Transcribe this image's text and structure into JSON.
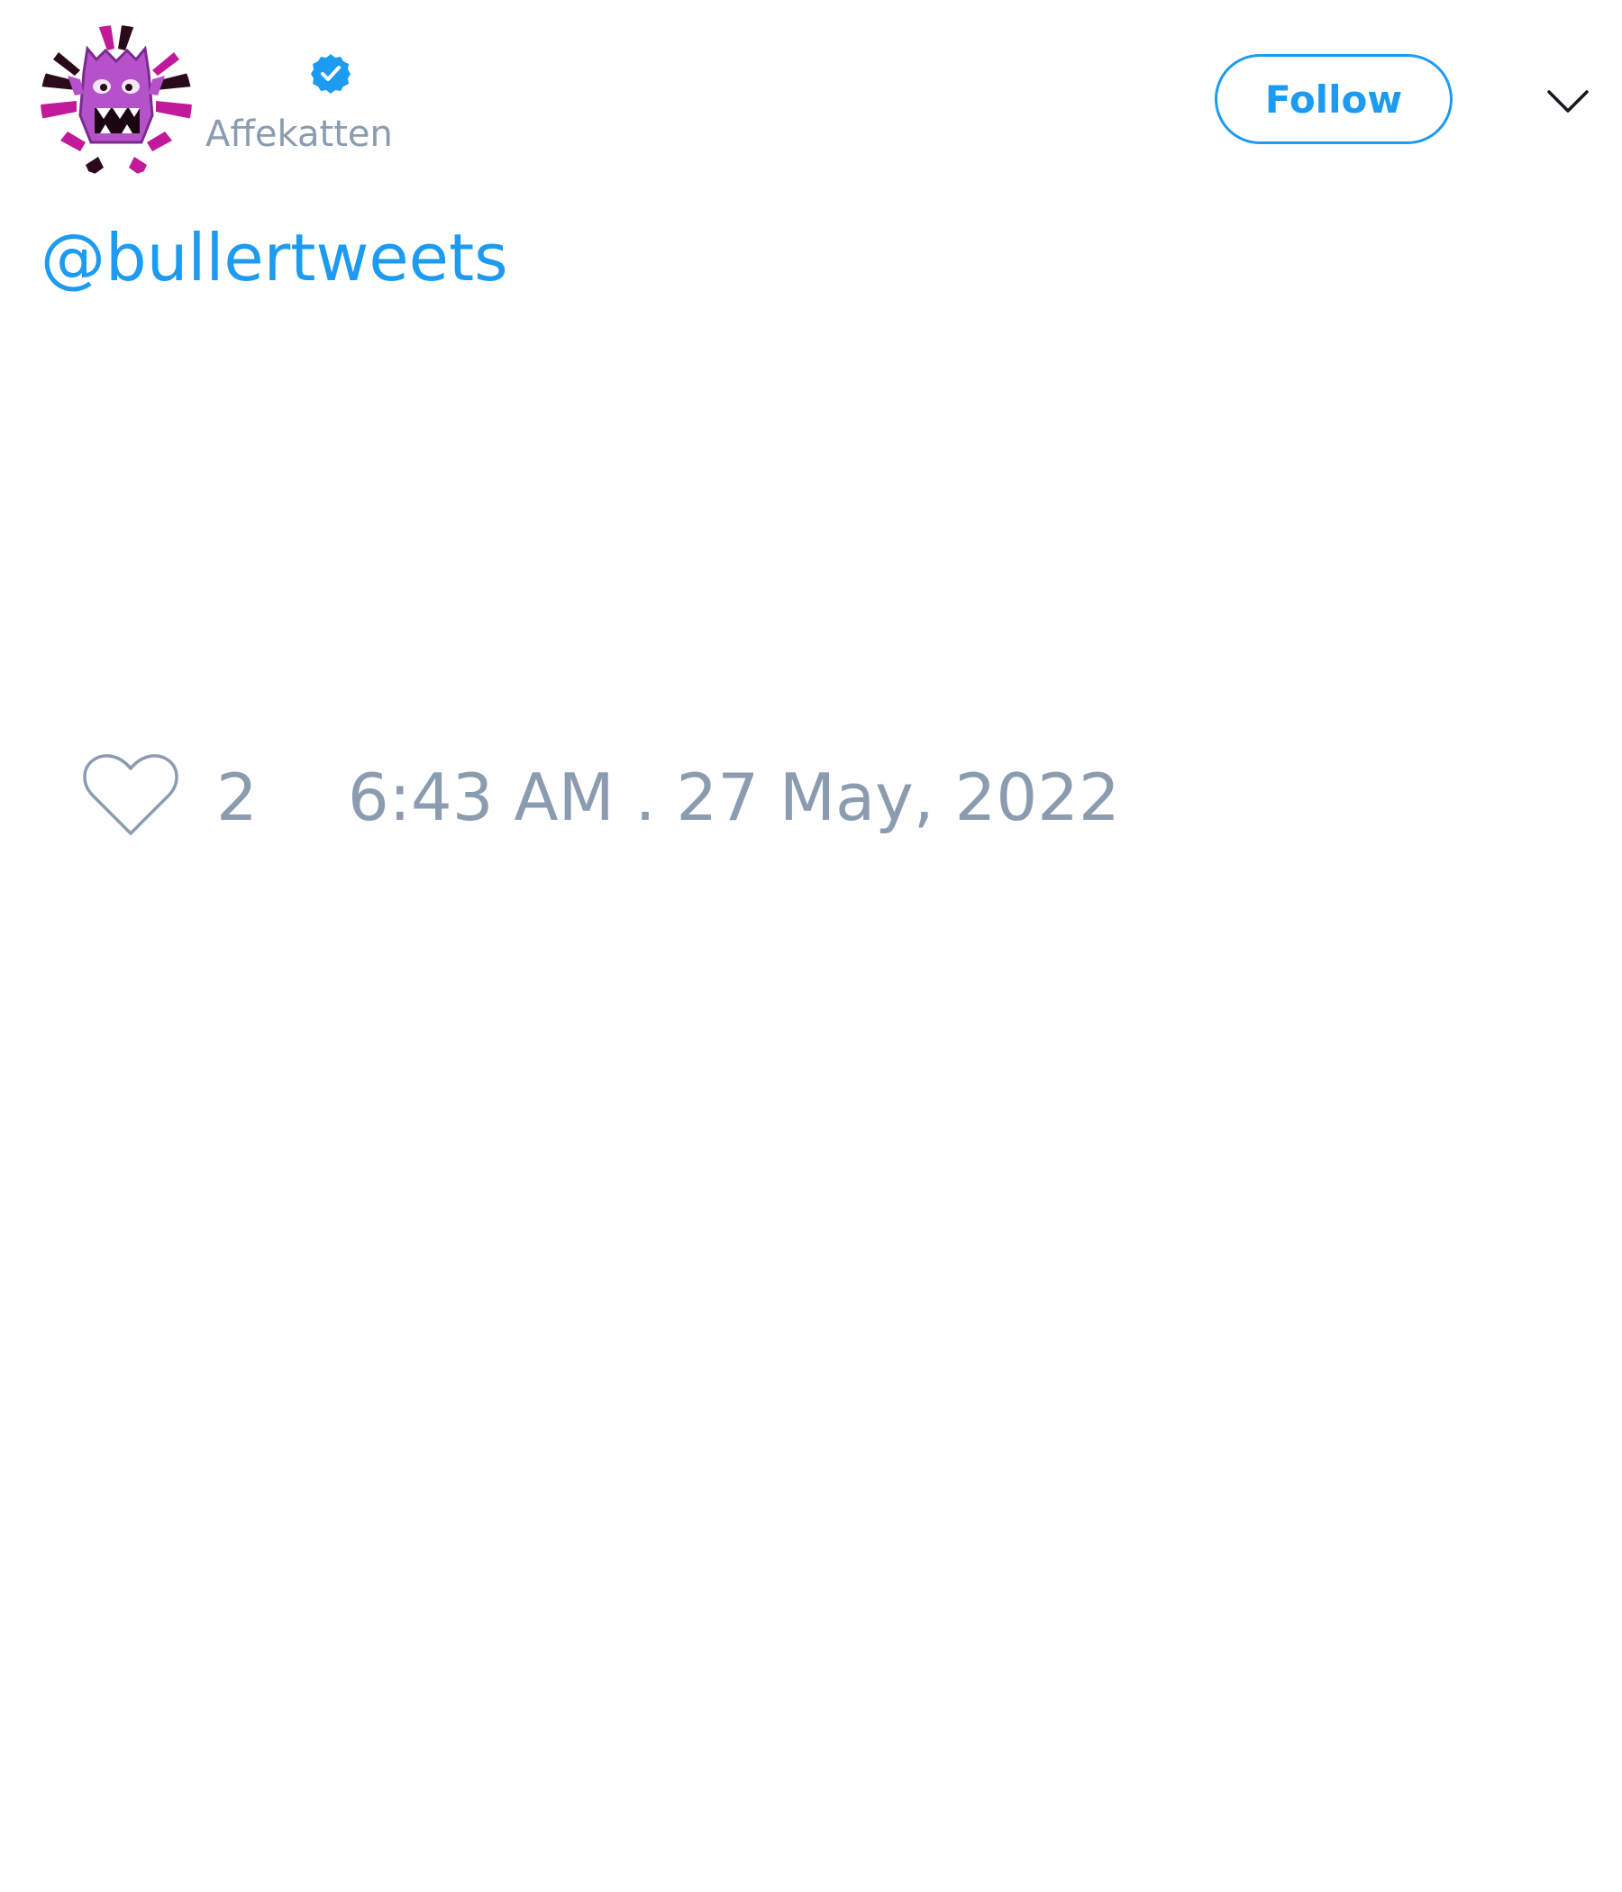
{
  "tweet": {
    "author": {
      "display_name": "",
      "handle": "Affekatten",
      "verified": true,
      "avatar_icon": "purple-monster-avatar"
    },
    "follow_label": "Follow",
    "menu_icon": "chevron-down-icon",
    "text": "@bullertweets",
    "like_icon": "heart-icon",
    "like_count": "2",
    "timestamp": "6:43 AM . 27 May, 2022"
  },
  "colors": {
    "accent": "#1d9bf0",
    "muted": "#8b9cb0",
    "text": "#14171a",
    "background": "#ffffff"
  }
}
